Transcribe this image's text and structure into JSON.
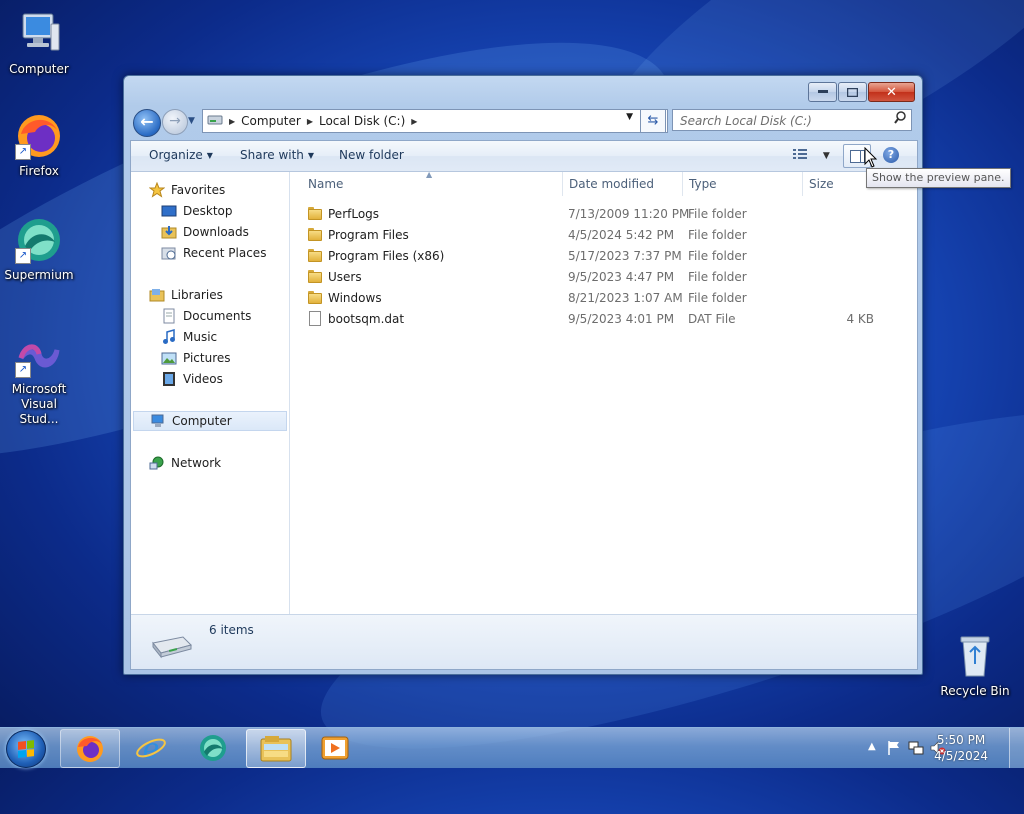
{
  "desktop": {
    "icons": [
      {
        "label": "Computer",
        "icon": "computer-icon"
      },
      {
        "label": "Firefox",
        "icon": "firefox-icon"
      },
      {
        "label": "Supermium",
        "icon": "supermium-icon"
      },
      {
        "label": "Microsoft Visual Stud...",
        "icon": "visual-studio-icon"
      },
      {
        "label": "Recycle Bin",
        "icon": "recycle-bin-icon"
      }
    ]
  },
  "window": {
    "address": {
      "crumbs": [
        "Computer",
        "Local Disk (C:)"
      ]
    },
    "search": {
      "placeholder": "Search Local Disk (C:)"
    },
    "commands": {
      "organize": "Organize",
      "share_with": "Share with",
      "new_folder": "New folder"
    },
    "tooltip": "Show the preview pane.",
    "nav": {
      "favorites": "Favorites",
      "desktop": "Desktop",
      "downloads": "Downloads",
      "recent_places": "Recent Places",
      "libraries": "Libraries",
      "documents": "Documents",
      "music": "Music",
      "pictures": "Pictures",
      "videos": "Videos",
      "computer": "Computer",
      "network": "Network"
    },
    "columns": {
      "name": "Name",
      "date": "Date modified",
      "type": "Type",
      "size": "Size"
    },
    "files": [
      {
        "name": "PerfLogs",
        "date": "7/13/2009 11:20 PM",
        "type": "File folder",
        "size": "",
        "kind": "folder"
      },
      {
        "name": "Program Files",
        "date": "4/5/2024 5:42 PM",
        "type": "File folder",
        "size": "",
        "kind": "folder"
      },
      {
        "name": "Program Files (x86)",
        "date": "5/17/2023 7:37 PM",
        "type": "File folder",
        "size": "",
        "kind": "folder"
      },
      {
        "name": "Users",
        "date": "9/5/2023 4:47 PM",
        "type": "File folder",
        "size": "",
        "kind": "folder"
      },
      {
        "name": "Windows",
        "date": "8/21/2023 1:07 AM",
        "type": "File folder",
        "size": "",
        "kind": "folder"
      },
      {
        "name": "bootsqm.dat",
        "date": "9/5/2023 4:01 PM",
        "type": "DAT File",
        "size": "4 KB",
        "kind": "file"
      }
    ],
    "status": {
      "count": "6 items"
    }
  },
  "taskbar": {
    "apps": [
      "firefox-icon",
      "internet-explorer-icon",
      "supermium-icon",
      "file-explorer-icon",
      "media-player-icon"
    ],
    "clock": {
      "time": "5:50 PM",
      "date": "4/5/2024"
    }
  },
  "colors": {
    "accent": "#1f5fb6",
    "selection": "#dbe8f8"
  }
}
